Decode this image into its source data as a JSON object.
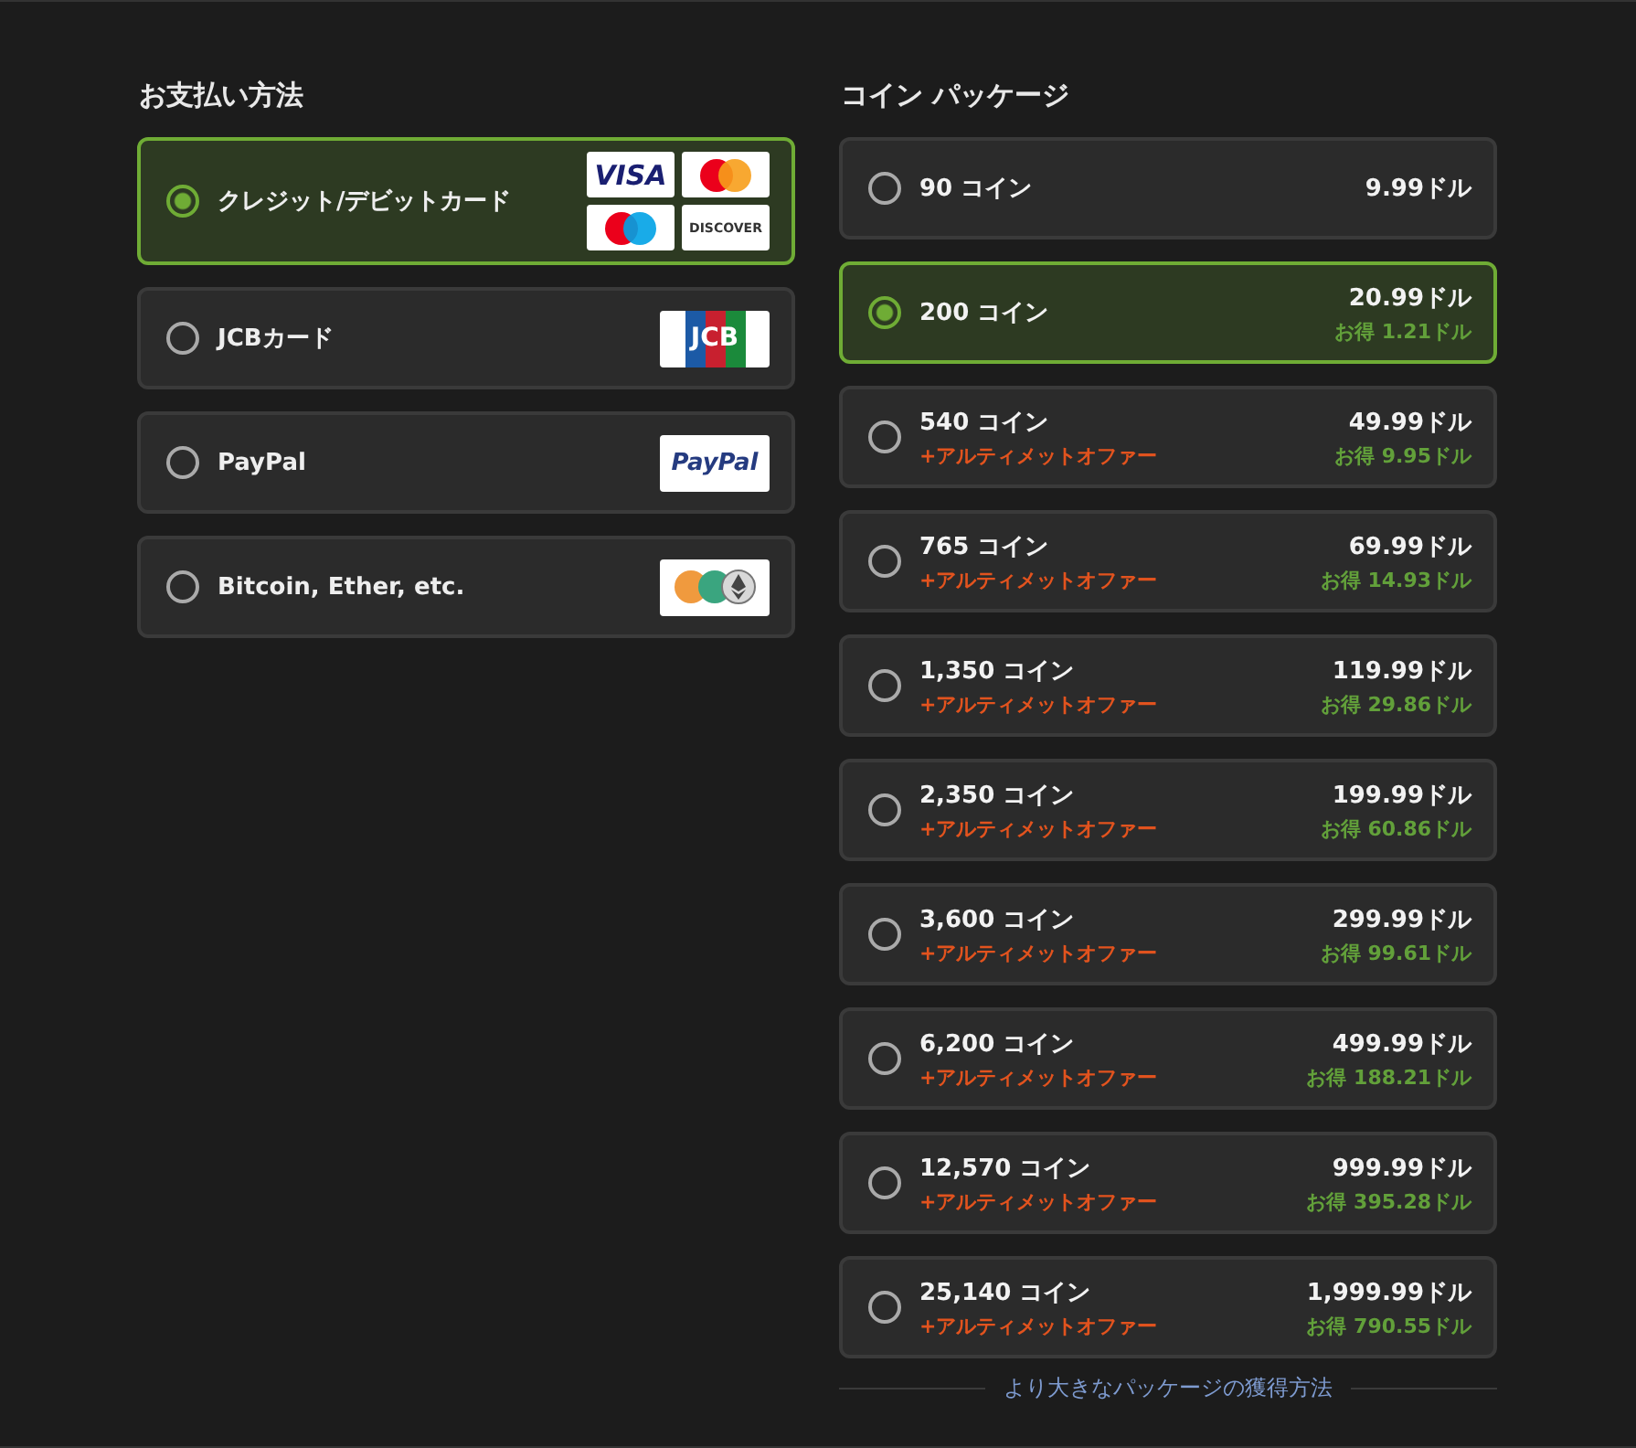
{
  "payment": {
    "title": "お支払い方法",
    "methods": [
      {
        "label": "クレジット/デビットカード",
        "selected": true,
        "logos": [
          {
            "kind": "visa",
            "text": "VISA"
          },
          {
            "kind": "mastercard"
          },
          {
            "kind": "maestro"
          },
          {
            "kind": "discover",
            "text": "DISCOVER"
          }
        ]
      },
      {
        "label": "JCBカード",
        "selected": false,
        "logos": [
          {
            "kind": "jcb",
            "text": "JCB"
          }
        ]
      },
      {
        "label": "PayPal",
        "selected": false,
        "logos": [
          {
            "kind": "paypal",
            "text": "PayPal"
          }
        ]
      },
      {
        "label": "Bitcoin, Ether, etc.",
        "selected": false,
        "logos": [
          {
            "kind": "crypto"
          }
        ]
      }
    ]
  },
  "packages": {
    "title": "コイン パッケージ",
    "items": [
      {
        "coins": "90 コイン",
        "price": "9.99ドル",
        "selected": false
      },
      {
        "coins": "200 コイン",
        "price": "20.99ドル",
        "savings": "お得 1.21ドル",
        "selected": true
      },
      {
        "coins": "540 コイン",
        "offer": "+アルティメットオファー",
        "price": "49.99ドル",
        "savings": "お得 9.95ドル",
        "selected": false
      },
      {
        "coins": "765 コイン",
        "offer": "+アルティメットオファー",
        "price": "69.99ドル",
        "savings": "お得 14.93ドル",
        "selected": false
      },
      {
        "coins": "1,350 コイン",
        "offer": "+アルティメットオファー",
        "price": "119.99ドル",
        "savings": "お得 29.86ドル",
        "selected": false
      },
      {
        "coins": "2,350 コイン",
        "offer": "+アルティメットオファー",
        "price": "199.99ドル",
        "savings": "お得 60.86ドル",
        "selected": false
      },
      {
        "coins": "3,600 コイン",
        "offer": "+アルティメットオファー",
        "price": "299.99ドル",
        "savings": "お得 99.61ドル",
        "selected": false
      },
      {
        "coins": "6,200 コイン",
        "offer": "+アルティメットオファー",
        "price": "499.99ドル",
        "savings": "お得 188.21ドル",
        "selected": false
      },
      {
        "coins": "12,570 コイン",
        "offer": "+アルティメットオファー",
        "price": "999.99ドル",
        "savings": "お得 395.28ドル",
        "selected": false
      },
      {
        "coins": "25,140 コイン",
        "offer": "+アルティメットオファー",
        "price": "1,999.99ドル",
        "savings": "お得 790.55ドル",
        "selected": false
      }
    ],
    "more_link": "より大きなパッケージの獲得方法"
  }
}
